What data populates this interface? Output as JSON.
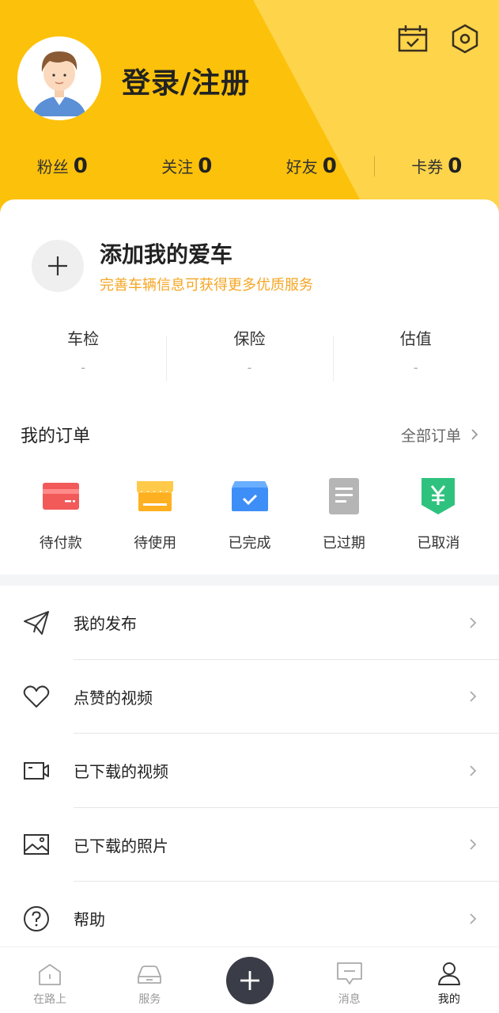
{
  "header": {
    "login_title": "登录/注册",
    "stats": [
      {
        "label": "粉丝",
        "value": "0"
      },
      {
        "label": "关注",
        "value": "0"
      },
      {
        "label": "好友",
        "value": "0"
      },
      {
        "label": "卡券",
        "value": "0"
      }
    ],
    "icons": [
      "calendar-check-icon",
      "settings-hexagon-icon"
    ],
    "color": "#FCC10A"
  },
  "car": {
    "add_title": "添加我的爱车",
    "add_subtitle": "完善车辆信息可获得更多优质服务",
    "stats": [
      {
        "label": "车检",
        "value": "-"
      },
      {
        "label": "保险",
        "value": "-"
      },
      {
        "label": "估值",
        "value": "-"
      }
    ]
  },
  "orders": {
    "title": "我的订单",
    "all_label": "全部订单",
    "items": [
      {
        "label": "待付款",
        "icon": "card-icon",
        "color": "#F25A5A"
      },
      {
        "label": "待使用",
        "icon": "shop-icon",
        "color": "#FFB020"
      },
      {
        "label": "已完成",
        "icon": "box-check-icon",
        "color": "#3E8EF7"
      },
      {
        "label": "已过期",
        "icon": "document-icon",
        "color": "#B0B0B0"
      },
      {
        "label": "已取消",
        "icon": "yen-badge-icon",
        "color": "#2EC27E"
      }
    ]
  },
  "menu": [
    {
      "label": "我的发布",
      "icon": "paper-plane-icon"
    },
    {
      "label": "点赞的视频",
      "icon": "heart-icon"
    },
    {
      "label": "已下载的视频",
      "icon": "video-camera-icon"
    },
    {
      "label": "已下载的照片",
      "icon": "image-icon"
    },
    {
      "label": "帮助",
      "icon": "help-icon"
    }
  ],
  "tabbar": {
    "tabs": [
      {
        "label": "在路上",
        "icon": "home-icon"
      },
      {
        "label": "服务",
        "icon": "car-icon"
      },
      {
        "label": "消息",
        "icon": "message-icon"
      },
      {
        "label": "我的",
        "icon": "user-icon"
      }
    ],
    "active": "我的"
  }
}
